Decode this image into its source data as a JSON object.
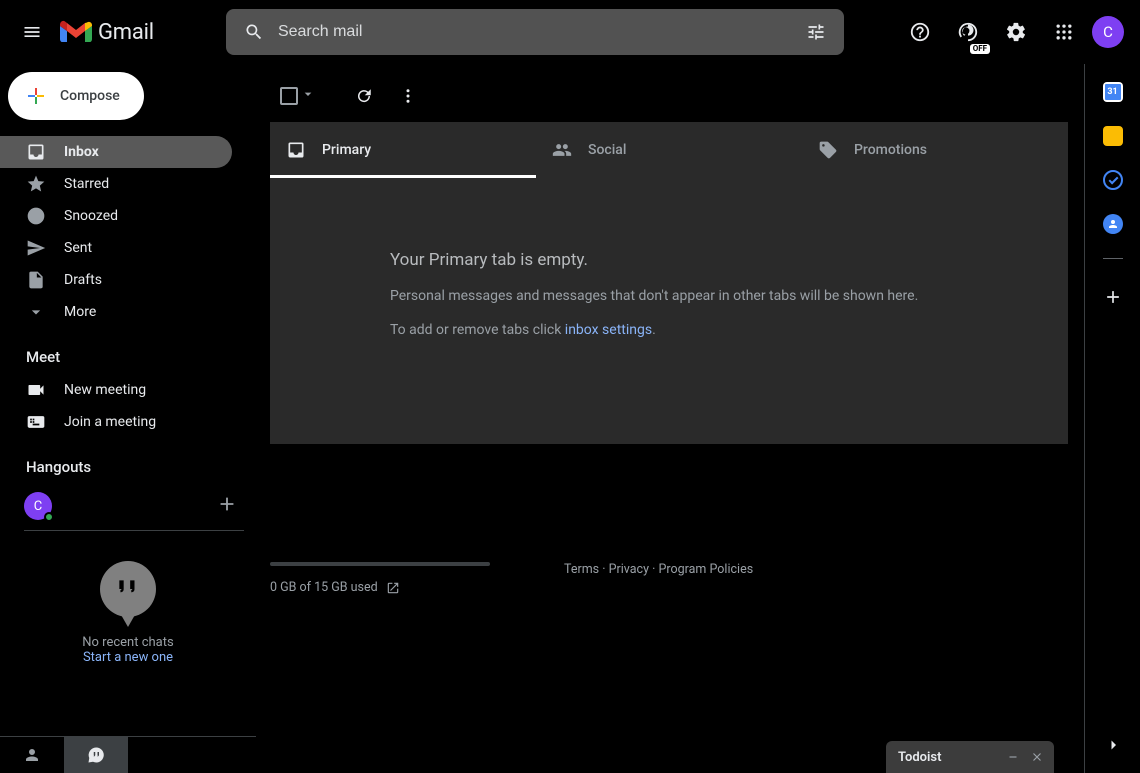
{
  "header": {
    "logo_text": "Gmail",
    "search_placeholder": "Search mail",
    "status_badge": "OFF",
    "avatar_initial": "C"
  },
  "sidebar": {
    "compose": "Compose",
    "items": [
      {
        "label": "Inbox",
        "icon": "inbox-icon",
        "active": true
      },
      {
        "label": "Starred",
        "icon": "star-icon",
        "active": false
      },
      {
        "label": "Snoozed",
        "icon": "clock-icon",
        "active": false
      },
      {
        "label": "Sent",
        "icon": "send-icon",
        "active": false
      },
      {
        "label": "Drafts",
        "icon": "draft-icon",
        "active": false
      },
      {
        "label": "More",
        "icon": "expand-icon",
        "active": false
      }
    ],
    "meet": {
      "title": "Meet",
      "items": [
        {
          "label": "New meeting",
          "icon": "video-icon"
        },
        {
          "label": "Join a meeting",
          "icon": "keyboard-icon"
        }
      ]
    },
    "hangouts": {
      "title": "Hangouts",
      "avatar_initial": "C",
      "empty_line1": "No recent chats",
      "empty_line2": "Start a new one"
    }
  },
  "tabs": [
    {
      "label": "Primary",
      "icon": "inbox-icon",
      "active": true
    },
    {
      "label": "Social",
      "icon": "people-icon",
      "active": false
    },
    {
      "label": "Promotions",
      "icon": "tag-icon",
      "active": false
    }
  ],
  "empty_state": {
    "heading": "Your Primary tab is empty.",
    "line1": "Personal messages and messages that don't appear in other tabs will be shown here.",
    "line2_prefix": "To add or remove tabs click ",
    "line2_link": "inbox settings",
    "line2_suffix": "."
  },
  "footer": {
    "storage": "0 GB of 15 GB used",
    "links": {
      "terms": "Terms",
      "privacy": "Privacy",
      "policies": "Program Policies"
    },
    "sep": " · "
  },
  "sidepanel": {
    "calendar_day": "31"
  },
  "todoist": {
    "title": "Todoist"
  }
}
